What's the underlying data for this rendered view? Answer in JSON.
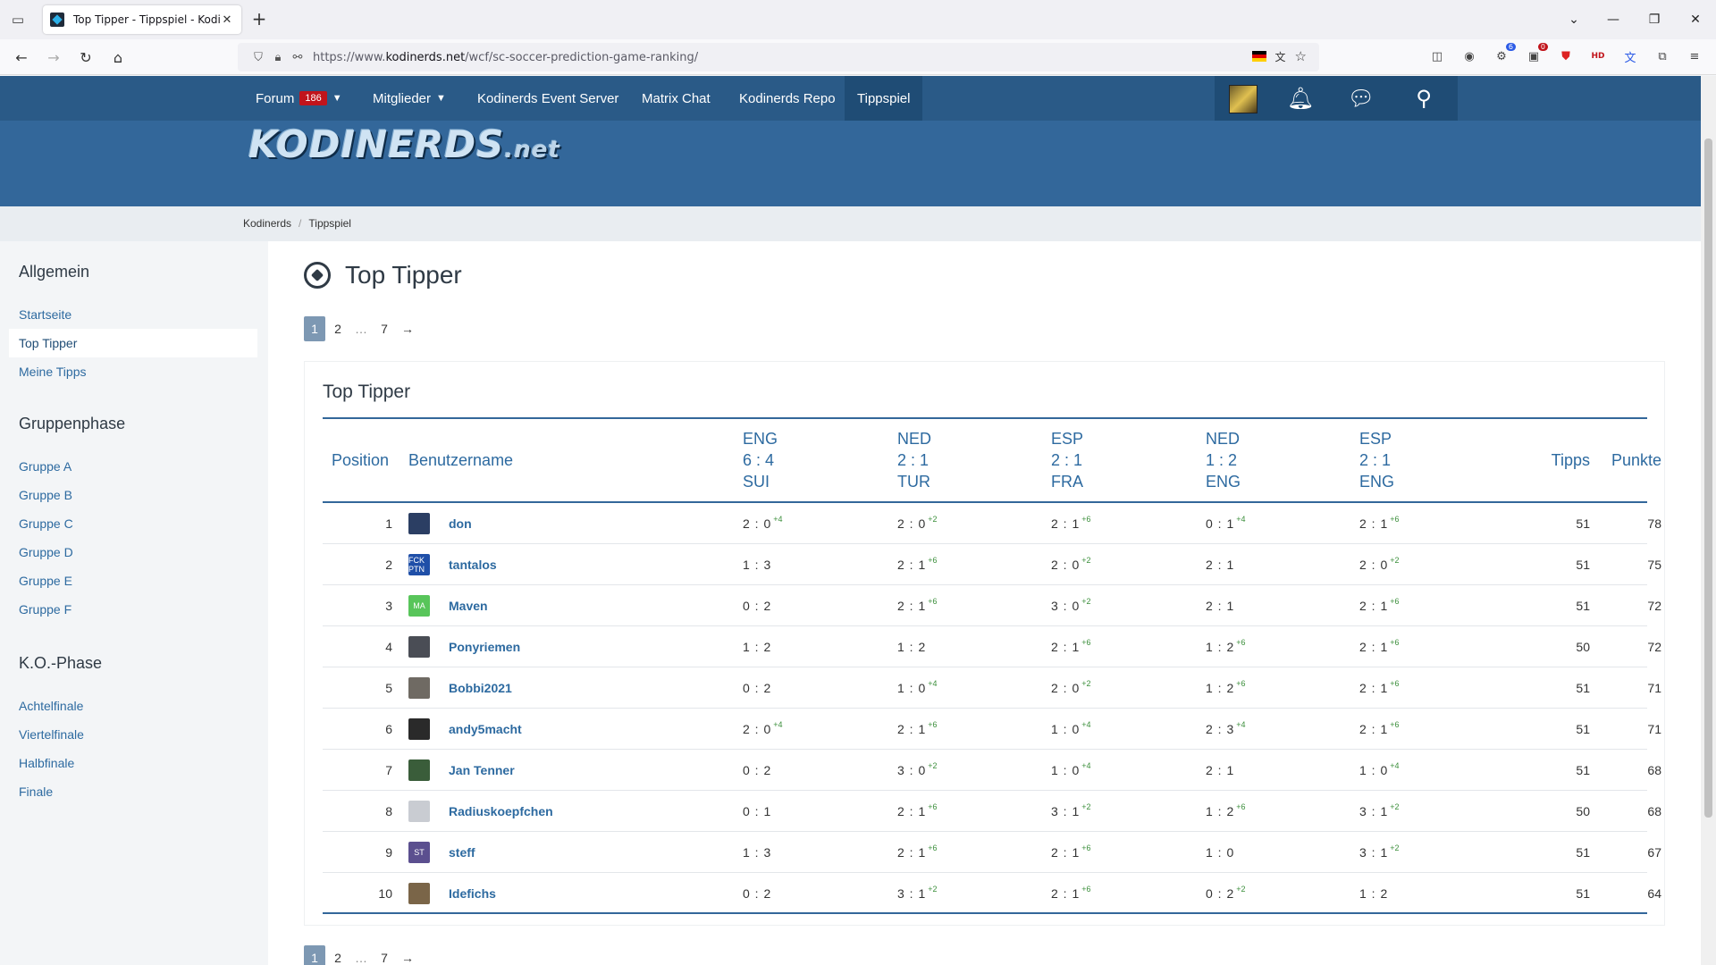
{
  "browser": {
    "tab_title": "Top Tipper - Tippspiel - Kodinerds",
    "url_prefix": "https://www.",
    "url_domain": "kodinerds.net",
    "url_path": "/wcf/sc-soccer-prediction-game-ranking/"
  },
  "topnav": {
    "forum_label": "Forum",
    "forum_badge": "186",
    "members_label": "Mitglieder",
    "event_server_label": "Kodinerds Event Server",
    "matrix_label": "Matrix Chat",
    "repo_label": "Kodinerds Repo",
    "tippspiel_label": "Tippspiel"
  },
  "logo": {
    "main": "KODINERDS",
    "suffix": ".net"
  },
  "breadcrumb": [
    "Kodinerds",
    "Tippspiel"
  ],
  "sidebar": {
    "general_heading": "Allgemein",
    "general_items": [
      "Startseite",
      "Top Tipper",
      "Meine Tipps"
    ],
    "group_heading": "Gruppenphase",
    "group_items": [
      "Gruppe A",
      "Gruppe B",
      "Gruppe C",
      "Gruppe D",
      "Gruppe E",
      "Gruppe F"
    ],
    "ko_heading": "K.O.-Phase",
    "ko_items": [
      "Achtelfinale",
      "Viertelfinale",
      "Halbfinale",
      "Finale"
    ]
  },
  "page": {
    "title": "Top Tipper",
    "box_title": "Top Tipper",
    "pager": [
      "1",
      "2",
      "…",
      "7",
      "→"
    ]
  },
  "table": {
    "col_position": "Position",
    "col_username": "Benutzername",
    "matches": [
      [
        "ENG",
        "6 : 4",
        "SUI"
      ],
      [
        "NED",
        "2 : 1",
        "TUR"
      ],
      [
        "ESP",
        "2 : 1",
        "FRA"
      ],
      [
        "NED",
        "1 : 2",
        "ENG"
      ],
      [
        "ESP",
        "2 : 1",
        "ENG"
      ]
    ],
    "col_tipps": "Tipps",
    "col_punkte": "Punkte",
    "rows": [
      {
        "pos": "1",
        "user": "don",
        "avatar_color": "#2b3e63",
        "avatar_text": "",
        "tips": [
          [
            "2 : 0",
            "+4"
          ],
          [
            "2 : 0",
            "+2"
          ],
          [
            "2 : 1",
            "+6"
          ],
          [
            "0 : 1",
            "+4"
          ],
          [
            "2 : 1",
            "+6"
          ]
        ],
        "tipps": "51",
        "punkte": "78"
      },
      {
        "pos": "2",
        "user": "tantalos",
        "avatar_color": "#1f4fa8",
        "avatar_text": "FCK PTN",
        "tips": [
          [
            "1 : 3",
            ""
          ],
          [
            "2 : 1",
            "+6"
          ],
          [
            "2 : 0",
            "+2"
          ],
          [
            "2 : 1",
            ""
          ],
          [
            "2 : 0",
            "+2"
          ]
        ],
        "tipps": "51",
        "punkte": "75"
      },
      {
        "pos": "3",
        "user": "Maven",
        "avatar_color": "#58c55a",
        "avatar_text": "MA",
        "tips": [
          [
            "0 : 2",
            ""
          ],
          [
            "2 : 1",
            "+6"
          ],
          [
            "3 : 0",
            "+2"
          ],
          [
            "2 : 1",
            ""
          ],
          [
            "2 : 1",
            "+6"
          ]
        ],
        "tipps": "51",
        "punkte": "72"
      },
      {
        "pos": "4",
        "user": "Ponyriemen",
        "avatar_color": "#4a4d55",
        "avatar_text": "",
        "tips": [
          [
            "1 : 2",
            ""
          ],
          [
            "1 : 2",
            ""
          ],
          [
            "2 : 1",
            "+6"
          ],
          [
            "1 : 2",
            "+6"
          ],
          [
            "2 : 1",
            "+6"
          ]
        ],
        "tipps": "50",
        "punkte": "72"
      },
      {
        "pos": "5",
        "user": "Bobbi2021",
        "avatar_color": "#6f6a63",
        "avatar_text": "",
        "tips": [
          [
            "0 : 2",
            ""
          ],
          [
            "1 : 0",
            "+4"
          ],
          [
            "2 : 0",
            "+2"
          ],
          [
            "1 : 2",
            "+6"
          ],
          [
            "2 : 1",
            "+6"
          ]
        ],
        "tipps": "51",
        "punkte": "71"
      },
      {
        "pos": "6",
        "user": "andy5macht",
        "avatar_color": "#2a2a2a",
        "avatar_text": "",
        "tips": [
          [
            "2 : 0",
            "+4"
          ],
          [
            "2 : 1",
            "+6"
          ],
          [
            "1 : 0",
            "+4"
          ],
          [
            "2 : 3",
            "+4"
          ],
          [
            "2 : 1",
            "+6"
          ]
        ],
        "tipps": "51",
        "punkte": "71"
      },
      {
        "pos": "7",
        "user": "Jan Tenner",
        "avatar_color": "#3a5d3a",
        "avatar_text": "",
        "tips": [
          [
            "0 : 2",
            ""
          ],
          [
            "3 : 0",
            "+2"
          ],
          [
            "1 : 0",
            "+4"
          ],
          [
            "2 : 1",
            ""
          ],
          [
            "1 : 0",
            "+4"
          ]
        ],
        "tipps": "51",
        "punkte": "68"
      },
      {
        "pos": "8",
        "user": "Radiuskoepfchen",
        "avatar_color": "#c9ccd2",
        "avatar_text": "",
        "tips": [
          [
            "0 : 1",
            ""
          ],
          [
            "2 : 1",
            "+6"
          ],
          [
            "3 : 1",
            "+2"
          ],
          [
            "1 : 2",
            "+6"
          ],
          [
            "3 : 1",
            "+2"
          ]
        ],
        "tipps": "50",
        "punkte": "68"
      },
      {
        "pos": "9",
        "user": "steff",
        "avatar_color": "#5b4f8f",
        "avatar_text": "ST",
        "tips": [
          [
            "1 : 3",
            ""
          ],
          [
            "2 : 1",
            "+6"
          ],
          [
            "2 : 1",
            "+6"
          ],
          [
            "1 : 0",
            ""
          ],
          [
            "3 : 1",
            "+2"
          ]
        ],
        "tipps": "51",
        "punkte": "67"
      },
      {
        "pos": "10",
        "user": "Idefichs",
        "avatar_color": "#7a6548",
        "avatar_text": "",
        "tips": [
          [
            "0 : 2",
            ""
          ],
          [
            "3 : 1",
            "+2"
          ],
          [
            "2 : 1",
            "+6"
          ],
          [
            "0 : 2",
            "+2"
          ],
          [
            "1 : 2",
            ""
          ]
        ],
        "tipps": "51",
        "punkte": "64"
      }
    ]
  },
  "colors": {
    "header": "#33679a",
    "nav": "#2a5a87",
    "link": "#2d6aa0",
    "points_plus": "#3c8f3c"
  }
}
